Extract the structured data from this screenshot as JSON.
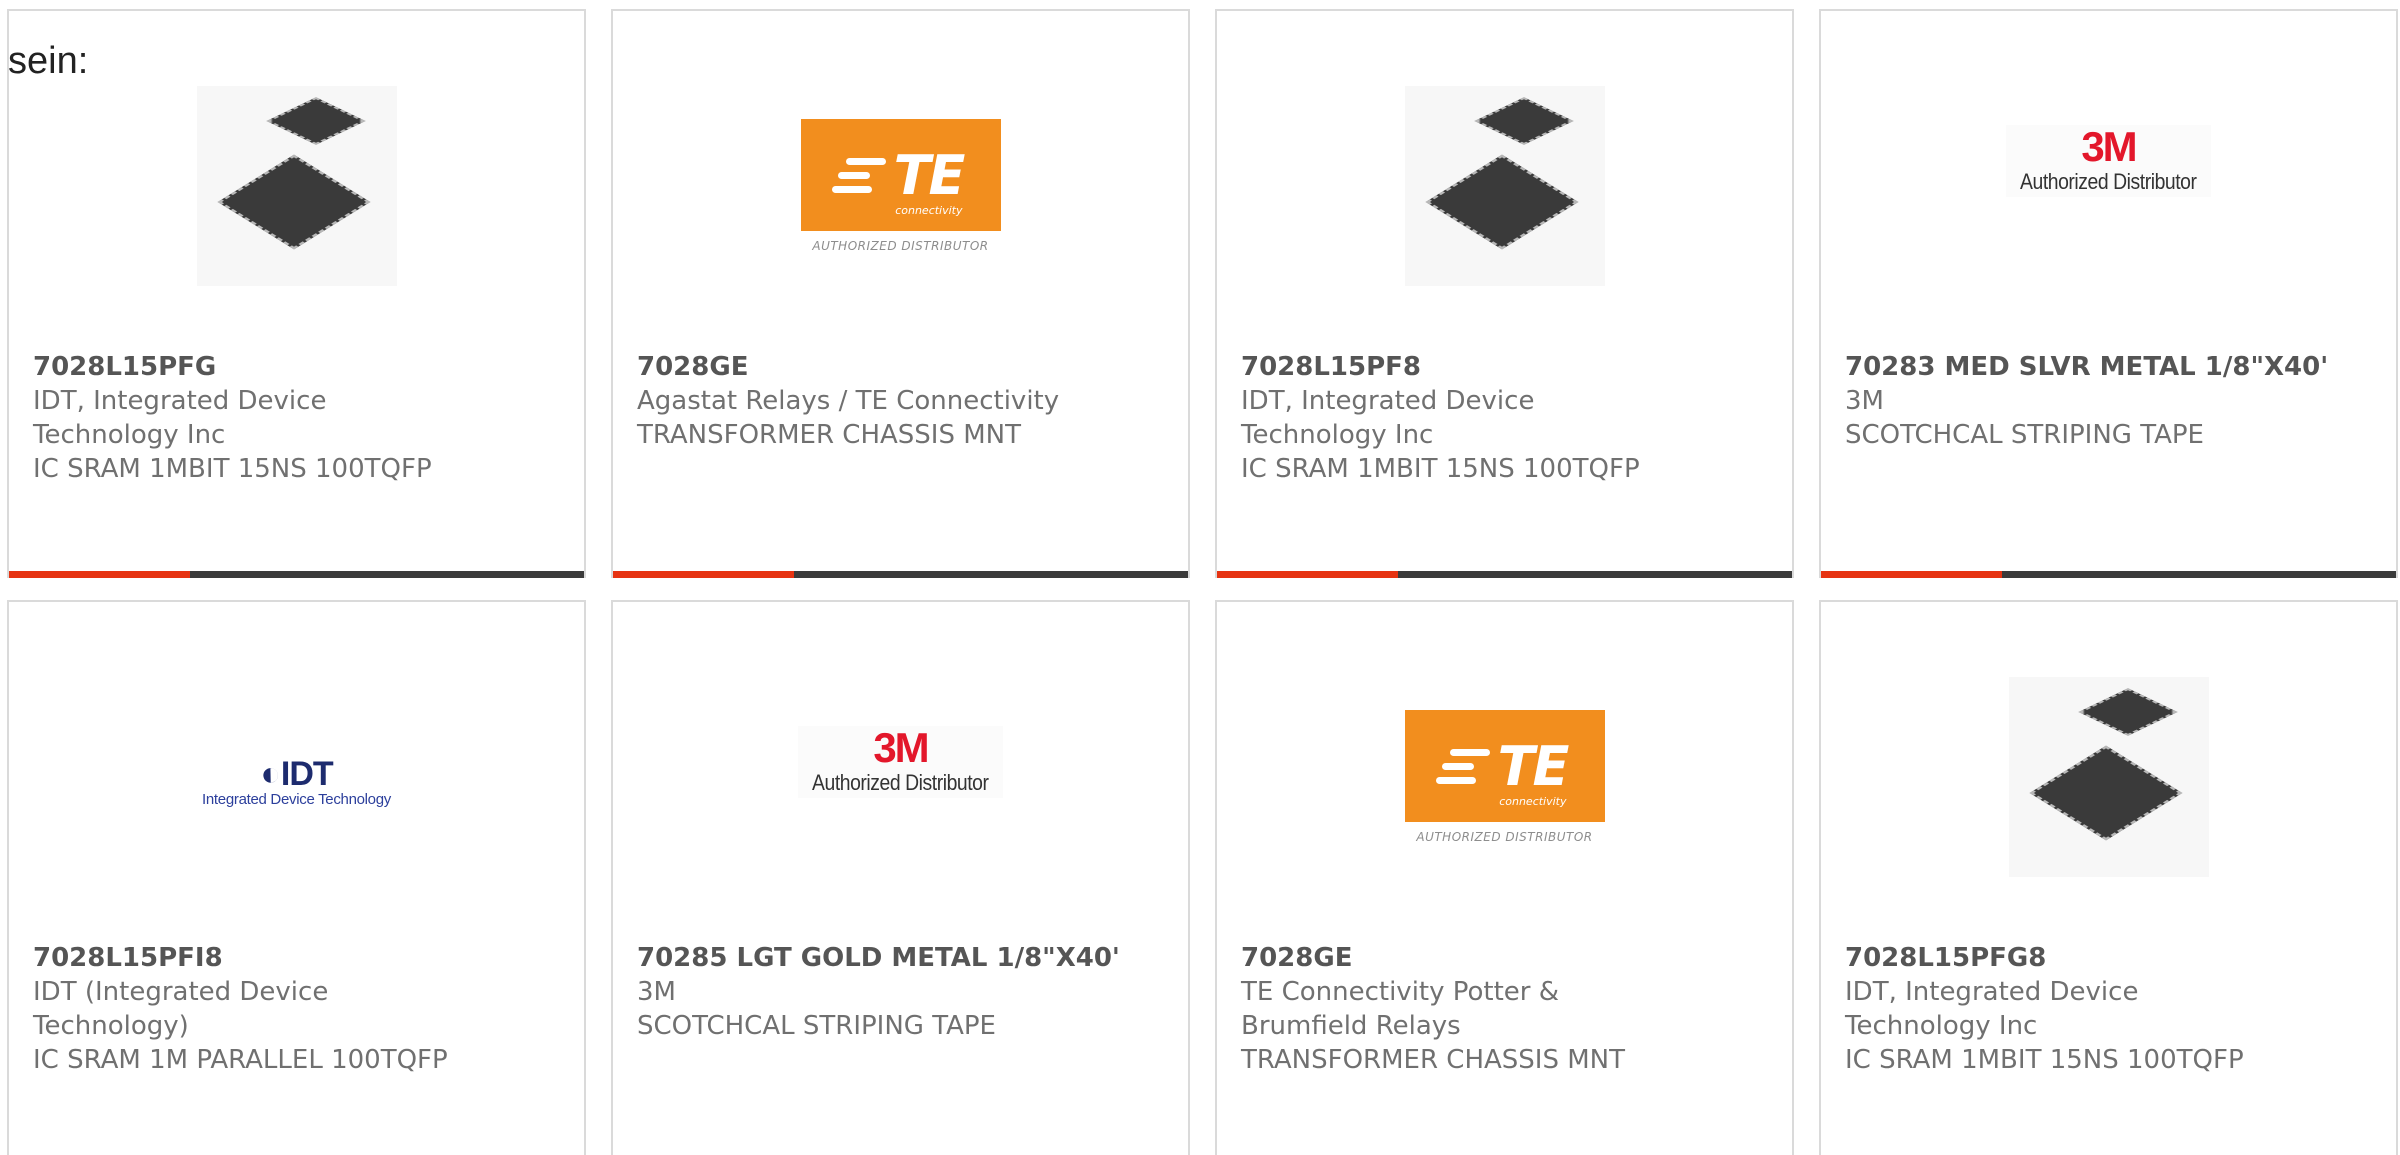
{
  "page": {
    "prefix_text": "sein:",
    "accent_color": "#e63312",
    "bar_color": "#3b3b3b"
  },
  "products": [
    {
      "part_number": "7028L15PFG",
      "manufacturer": "IDT, Integrated Device Technology Inc",
      "description": "IC SRAM 1MBIT 15NS 100TQFP",
      "image": "chip-package-image"
    },
    {
      "part_number": "7028GE",
      "manufacturer": "Agastat Relays / TE Connectivity",
      "description": "TRANSFORMER CHASSIS MNT",
      "image": "te-connectivity-logo",
      "logo": {
        "mark": "TE",
        "sub": "connectivity",
        "caption": "AUTHORIZED DISTRIBUTOR"
      }
    },
    {
      "part_number": "7028L15PF8",
      "manufacturer": "IDT, Integrated Device Technology Inc",
      "description": "IC SRAM 1MBIT 15NS 100TQFP",
      "image": "chip-package-image"
    },
    {
      "part_number": "70283 MED SLVR METAL 1/8\"X40'",
      "manufacturer": "3M",
      "description": "SCOTCHCAL STRIPING TAPE",
      "image": "3m-logo",
      "logo": {
        "mark": "3M",
        "caption": "Authorized Distributor"
      }
    },
    {
      "part_number": "7028L15PFI8",
      "manufacturer": "IDT (Integrated Device Technology)",
      "description": "IC SRAM 1M PARALLEL 100TQFP",
      "image": "idt-logo",
      "logo": {
        "mark": "IDT",
        "caption": "Integrated Device Technology"
      }
    },
    {
      "part_number": "70285 LGT GOLD METAL 1/8\"X40'",
      "manufacturer": "3M",
      "description": "SCOTCHCAL STRIPING TAPE",
      "image": "3m-logo",
      "logo": {
        "mark": "3M",
        "caption": "Authorized Distributor"
      }
    },
    {
      "part_number": "7028GE",
      "manufacturer": "TE Connectivity Potter & Brumfield Relays",
      "description": "TRANSFORMER CHASSIS MNT",
      "image": "te-connectivity-logo",
      "logo": {
        "mark": "TE",
        "sub": "connectivity",
        "caption": "AUTHORIZED DISTRIBUTOR"
      }
    },
    {
      "part_number": "7028L15PFG8",
      "manufacturer": "IDT, Integrated Device Technology Inc",
      "description": "IC SRAM 1MBIT 15NS 100TQFP",
      "image": "chip-package-image"
    }
  ]
}
